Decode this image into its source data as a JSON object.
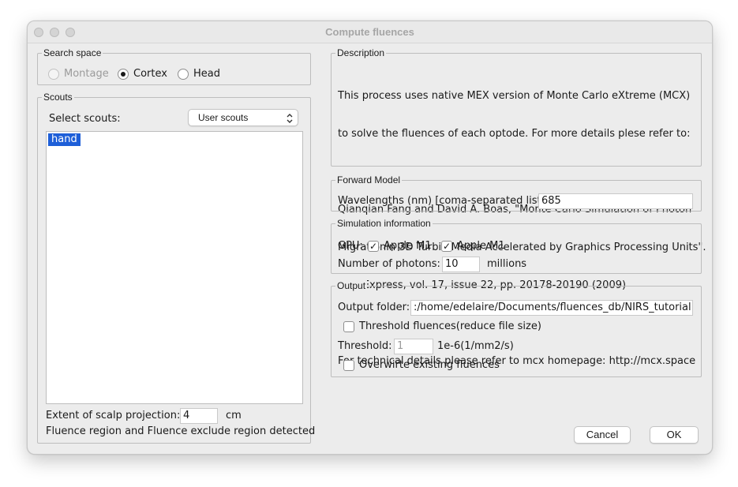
{
  "window": {
    "title": "Compute fluences"
  },
  "search_space": {
    "label": "Search space",
    "options": [
      "Montage",
      "Cortex",
      "Head"
    ],
    "selected": "Cortex"
  },
  "scouts": {
    "label": "Scouts",
    "select_label": "Select scouts:",
    "dropdown_value": "User scouts",
    "items": [
      "hand"
    ],
    "extent_label": "Extent of scalp projection:",
    "extent_value": "4",
    "extent_unit": "cm",
    "detected_text": "Fluence region and Fluence exclude region detected"
  },
  "description": {
    "label": "Description",
    "lines": [
      "This process uses native MEX version of Monte Carlo eXtreme (MCX)",
      "to solve the fluences of each optode. For more details plese refer to:",
      "",
      "Qianqian Fang and David A. Boas, \"Monte Carlo Simulation of Photon",
      "Migrationin 3D Turbid Media Accelerated by Graphics Processing Units\".",
      "Opt. Express, vol. 17, issue 22, pp. 20178-20190 (2009)",
      "",
      "For technical details please refer to mcx homepage: http://mcx.space"
    ]
  },
  "forward_model": {
    "label": "Forward Model",
    "wavelengths_label": "Wavelengths (nm) [coma-separated list]",
    "wavelengths_value": "685"
  },
  "simulation": {
    "label": "Simulation information",
    "gpu_label": "GPU:",
    "gpus": [
      "Apple M1",
      "Apple M1"
    ],
    "photons_label": "Number of photons:",
    "photons_value": "10",
    "photons_unit": "millions"
  },
  "output": {
    "label": "Output",
    "folder_label": "Output folder:",
    "folder_value": ":/home/edelaire/Documents/fluences_db/NIRS_tutorial",
    "threshold_check_label": "Threshold fluences(reduce file size)",
    "threshold_label": "Threshold:",
    "threshold_value": "1",
    "threshold_unit": "1e-6(1/mm2/s)",
    "overwrite_label": "Overwirte existing fluences"
  },
  "buttons": {
    "cancel": "Cancel",
    "ok": "OK"
  },
  "icons": {
    "checkmark": "✓",
    "chevron": "⌃⌄"
  }
}
